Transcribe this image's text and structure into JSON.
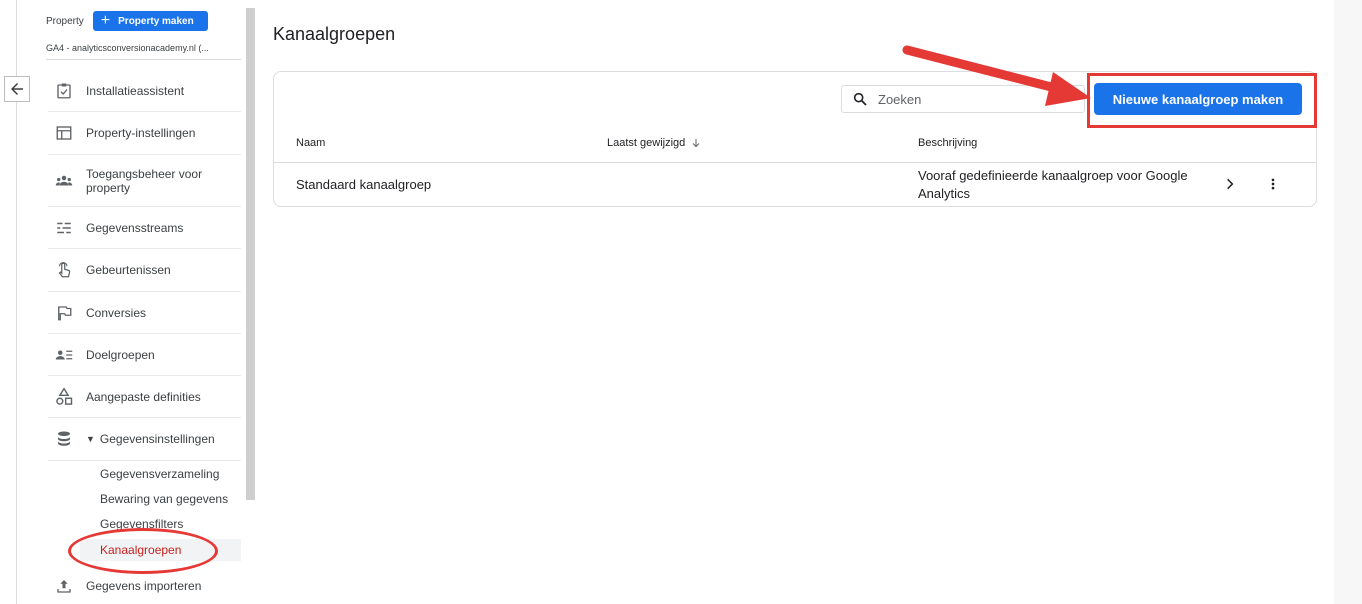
{
  "sidebar": {
    "property_label": "Property",
    "property_button": "Property maken",
    "property_name": "GA4 - analyticsconversionacademy.nl (...",
    "items": [
      {
        "label": "Installatieassistent",
        "icon": "checklist-icon"
      },
      {
        "label": "Property-instellingen",
        "icon": "layout-icon"
      },
      {
        "label": "Toegangsbeheer voor property",
        "icon": "people-icon"
      },
      {
        "label": "Gegevensstreams",
        "icon": "streams-icon"
      },
      {
        "label": "Gebeurtenissen",
        "icon": "touch-icon"
      },
      {
        "label": "Conversies",
        "icon": "flag-icon"
      },
      {
        "label": "Doelgroepen",
        "icon": "audience-icon"
      },
      {
        "label": "Aangepaste definities",
        "icon": "shapes-icon"
      },
      {
        "label": "Gegevensinstellingen",
        "icon": "database-icon"
      }
    ],
    "subitems": [
      {
        "label": "Gegevensverzameling"
      },
      {
        "label": "Bewaring van gegevens"
      },
      {
        "label": "Gegevensfilters"
      },
      {
        "label": "Kanaalgroepen",
        "active": true
      }
    ],
    "last_item": {
      "label": "Gegevens importeren",
      "icon": "upload-icon"
    }
  },
  "main": {
    "title": "Kanaalgroepen",
    "search_placeholder": "Zoeken",
    "new_button": "Nieuwe kanaalgroep maken",
    "columns": [
      "Naam",
      "Laatst gewijzigd",
      "Beschrijving"
    ],
    "rows": [
      {
        "name": "Standaard kanaalgroep",
        "modified": "",
        "description": "Vooraf gedefinieerde kanaalgroep voor Google Analytics"
      }
    ]
  },
  "colors": {
    "accent": "#1a73e8",
    "annotation": "#e53935",
    "active_text": "#c5221f"
  }
}
